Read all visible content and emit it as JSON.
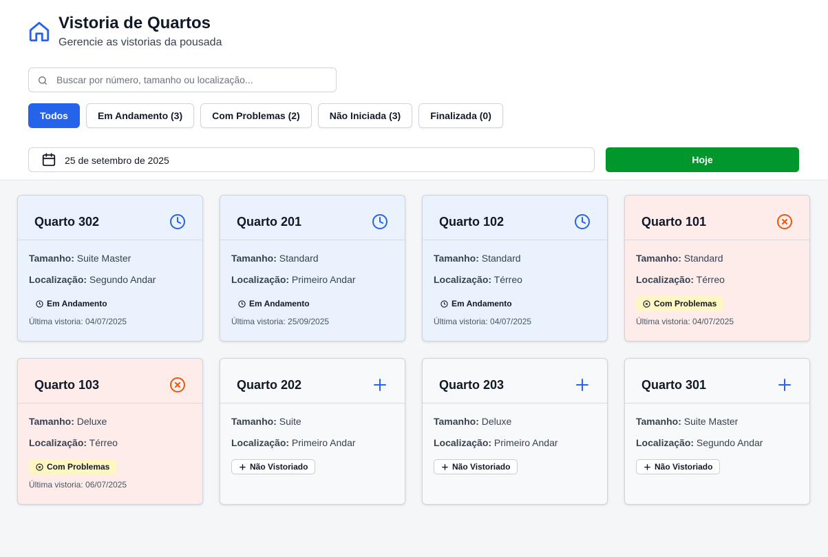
{
  "header": {
    "title": "Vistoria de Quartos",
    "subtitle": "Gerencie as vistorias da pousada",
    "icon": "home-icon"
  },
  "search": {
    "placeholder": "Buscar por número, tamanho ou localização...",
    "value": ""
  },
  "filters": [
    {
      "label": "Todos",
      "active": true
    },
    {
      "label": "Em Andamento (3)",
      "active": false
    },
    {
      "label": "Com Problemas (2)",
      "active": false
    },
    {
      "label": "Não Iniciada (3)",
      "active": false
    },
    {
      "label": "Finalizada (0)",
      "active": false
    }
  ],
  "date": {
    "value": "25 de setembro de 2025",
    "today_label": "Hoje"
  },
  "labels": {
    "size": "Tamanho:",
    "location": "Localização:"
  },
  "colors": {
    "primary": "#2563eb",
    "success": "#02972c",
    "problem": "#ea580c",
    "in_progress_bg": "#eaf2fd",
    "problem_bg": "#fdecea"
  },
  "rooms": [
    {
      "name": "Quarto 302",
      "size": "Suite Master",
      "location": "Segundo Andar",
      "status": "Em Andamento",
      "status_icon": "clock-icon",
      "last": "Última vistoria: 04/07/2025"
    },
    {
      "name": "Quarto 201",
      "size": "Standard",
      "location": "Primeiro Andar",
      "status": "Em Andamento",
      "status_icon": "clock-icon",
      "last": "Última vistoria: 25/09/2025"
    },
    {
      "name": "Quarto 102",
      "size": "Standard",
      "location": "Térreo",
      "status": "Em Andamento",
      "status_icon": "clock-icon",
      "last": "Última vistoria: 04/07/2025"
    },
    {
      "name": "Quarto 101",
      "size": "Standard",
      "location": "Térreo",
      "status": "Com Problemas",
      "status_icon": "x-circle-icon",
      "last": "Última vistoria: 04/07/2025"
    },
    {
      "name": "Quarto 103",
      "size": "Deluxe",
      "location": "Térreo",
      "status": "Com Problemas",
      "status_icon": "x-circle-icon",
      "last": "Última vistoria: 06/07/2025"
    },
    {
      "name": "Quarto 202",
      "size": "Suite",
      "location": "Primeiro Andar",
      "status": "Não Vistoriado",
      "status_icon": "plus-icon",
      "last": ""
    },
    {
      "name": "Quarto 203",
      "size": "Deluxe",
      "location": "Primeiro Andar",
      "status": "Não Vistoriado",
      "status_icon": "plus-icon",
      "last": ""
    },
    {
      "name": "Quarto 301",
      "size": "Suite Master",
      "location": "Segundo Andar",
      "status": "Não Vistoriado",
      "status_icon": "plus-icon",
      "last": ""
    }
  ]
}
